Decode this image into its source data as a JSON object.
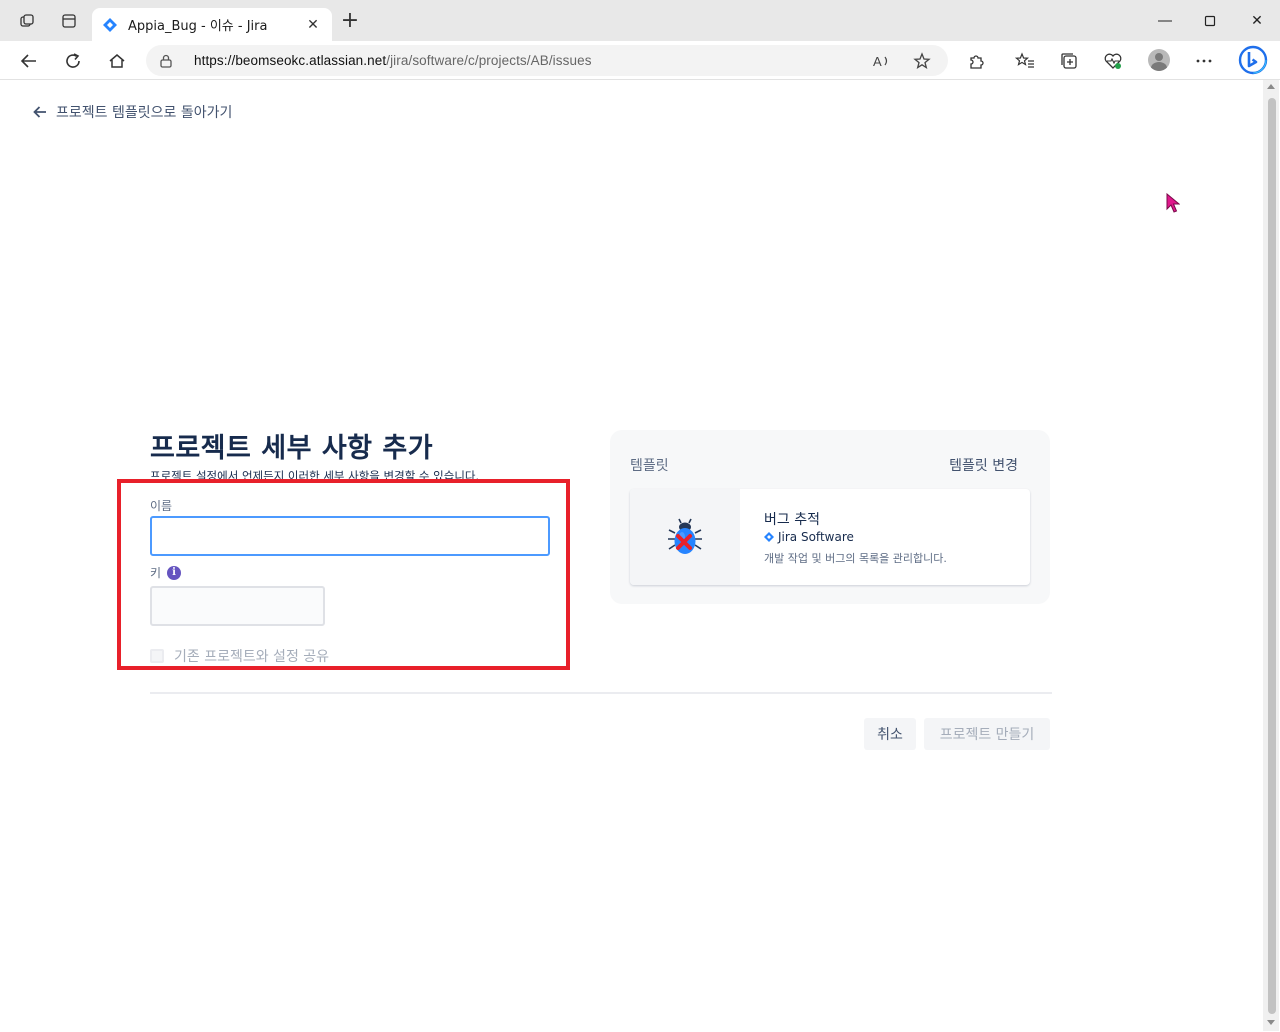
{
  "browser": {
    "tab_title": "Appia_Bug - 이슈 - Jira",
    "url_host": "https://beomseokc.atlassian.net",
    "url_path": "/jira/software/c/projects/AB/issues",
    "icons": [
      "workspaces-icon",
      "tab-actions-icon",
      "jira-favicon",
      "close-tab-icon",
      "new-tab-icon",
      "minimize-icon",
      "maximize-icon",
      "close-window-icon",
      "back-icon",
      "refresh-icon",
      "home-icon",
      "lock-icon",
      "read-aloud-icon",
      "favorite-icon",
      "extensions-icon",
      "favorites-icon",
      "collections-icon",
      "performance-icon",
      "profile-icon",
      "more-icon",
      "bing-icon"
    ]
  },
  "page": {
    "back_link": "프로젝트 템플릿으로 돌아가기",
    "heading": "프로젝트 세부 사항 추가",
    "subtext": "프로젝트 설정에서 언제든지 이러한 세부 사항을 변경할 수 있습니다.",
    "form": {
      "name_label": "이름",
      "name_value": "",
      "key_label": "키",
      "key_value": "",
      "share_label": "기존 프로젝트와 설정 공유",
      "share_checked": false
    },
    "template": {
      "section_label": "템플릿",
      "change_label": "템플릿 변경",
      "title": "버그 추적",
      "product": "Jira Software",
      "description": "개발 작업 및 버그의 목록을 관리합니다."
    },
    "buttons": {
      "cancel": "취소",
      "create": "프로젝트 만들기"
    }
  },
  "colors": {
    "highlight_border": "#e8202a",
    "input_focus": "#4c9aff",
    "jira_blue": "#2684ff",
    "info_purple": "#6554c0",
    "cursor": "#e0188c"
  }
}
